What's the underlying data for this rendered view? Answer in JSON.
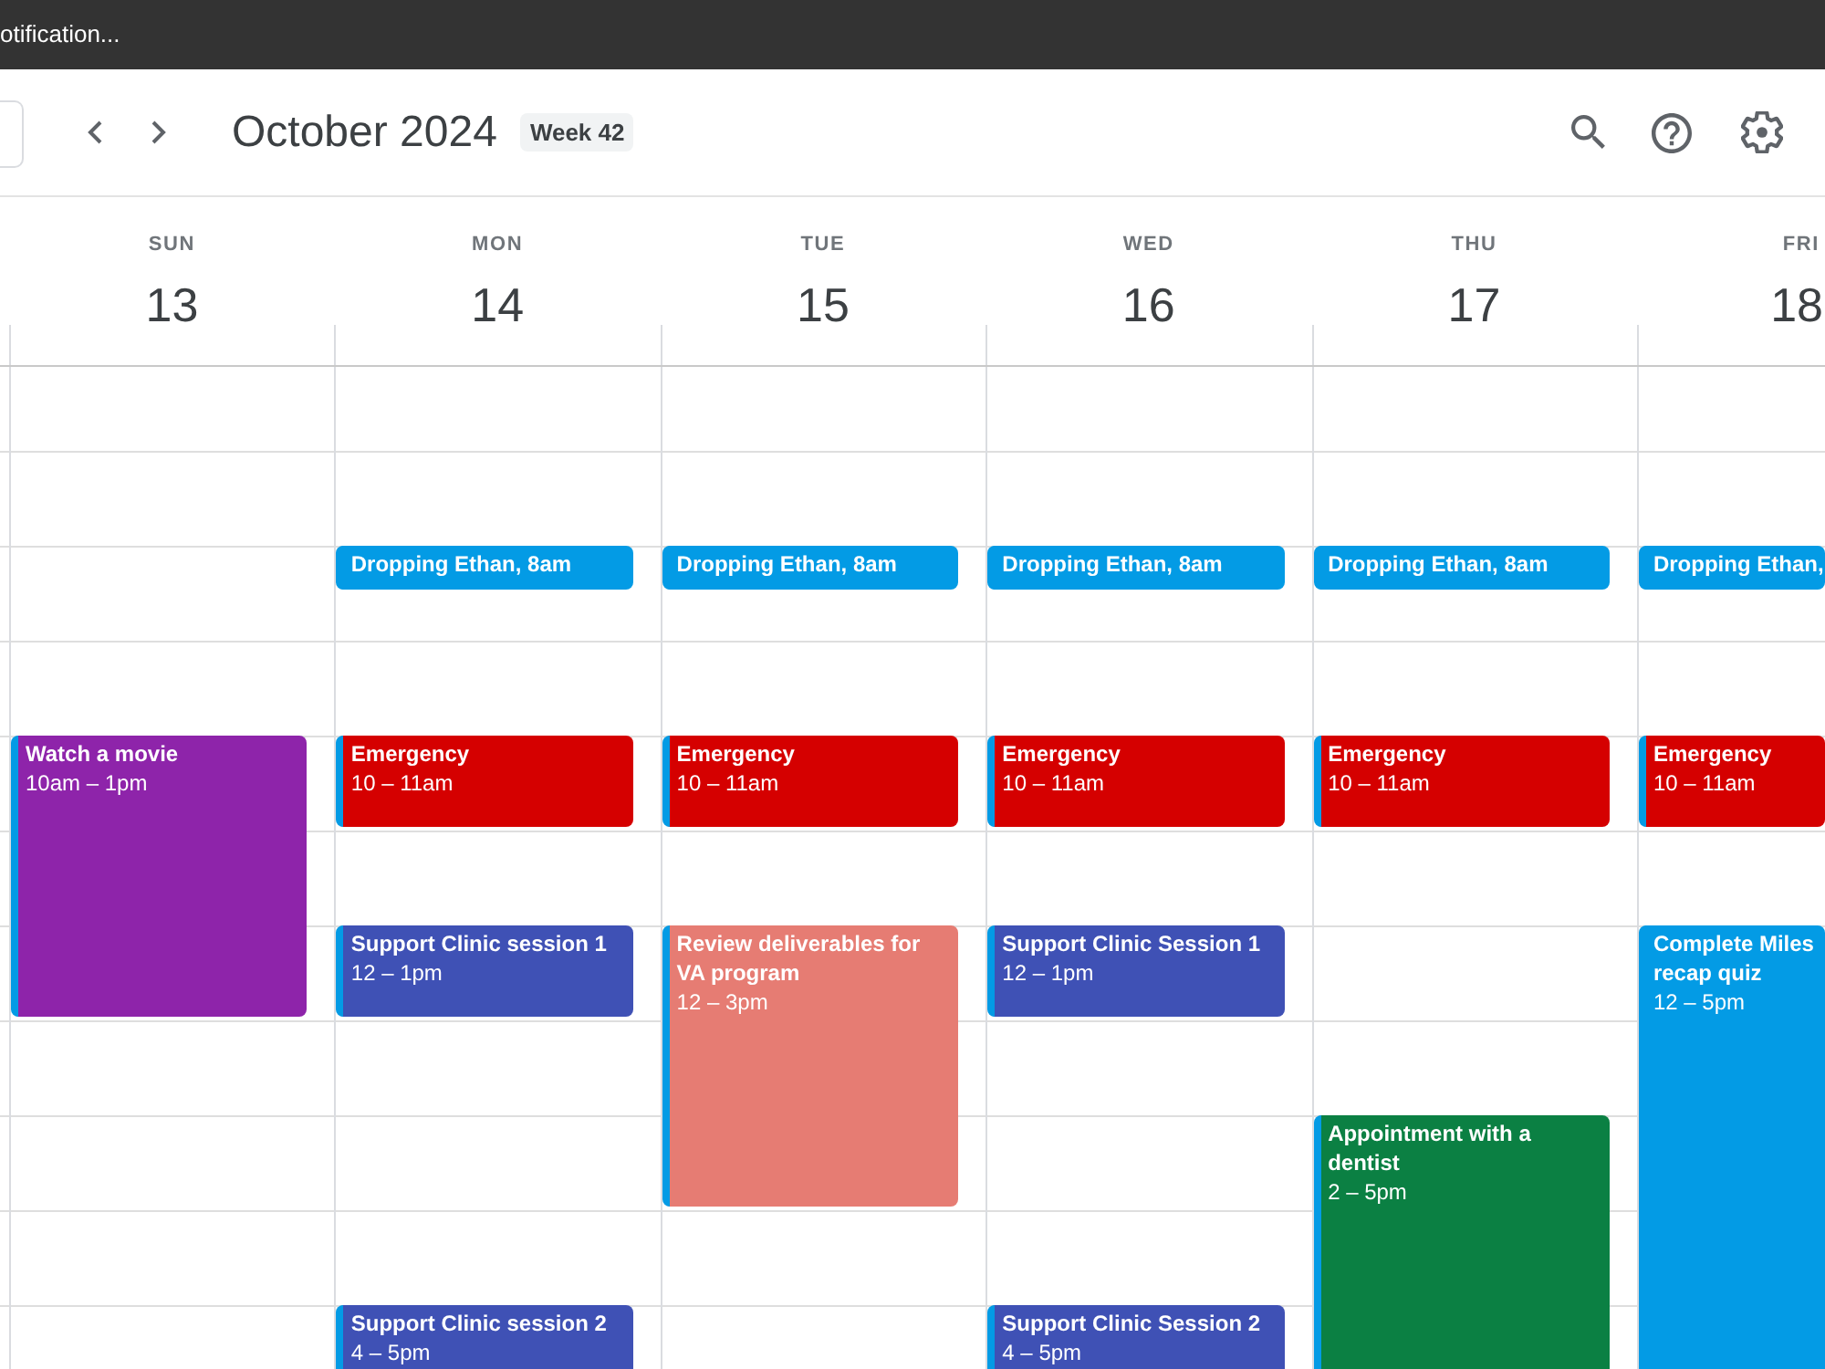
{
  "notification": {
    "text": "otification..."
  },
  "toolbar": {
    "title": "October 2024",
    "week_badge": "Week 42"
  },
  "days": [
    {
      "name": "SUN",
      "date": "13",
      "events": [
        {
          "kind": "block",
          "title": "Watch a movie",
          "time": "10am – 1pm",
          "color": "#8e24aa"
        }
      ]
    },
    {
      "name": "MON",
      "date": "14",
      "events": [
        {
          "kind": "short",
          "title": "Dropping Ethan, 8am",
          "color": "#039be5"
        },
        {
          "kind": "block",
          "title": "Emergency",
          "time": "10 – 11am",
          "color": "#d50000"
        },
        {
          "kind": "block",
          "title": "Support Clinic session 1",
          "time": "12 – 1pm",
          "color": "#3f51b5"
        },
        {
          "kind": "block",
          "title": "Support Clinic session 2",
          "time": "4 – 5pm",
          "color": "#3f51b5"
        }
      ]
    },
    {
      "name": "TUE",
      "date": "15",
      "events": [
        {
          "kind": "short",
          "title": "Dropping Ethan, 8am",
          "color": "#039be5"
        },
        {
          "kind": "block",
          "title": "Emergency",
          "time": "10 – 11am",
          "color": "#d50000"
        },
        {
          "kind": "block",
          "title": "Review deliverables for VA program",
          "time": "12 – 3pm",
          "color": "#e67c73"
        }
      ]
    },
    {
      "name": "WED",
      "date": "16",
      "events": [
        {
          "kind": "short",
          "title": "Dropping Ethan, 8am",
          "color": "#039be5"
        },
        {
          "kind": "block",
          "title": "Emergency",
          "time": "10 – 11am",
          "color": "#d50000"
        },
        {
          "kind": "block",
          "title": "Support Clinic Session 1",
          "time": "12 – 1pm",
          "color": "#3f51b5"
        },
        {
          "kind": "block",
          "title": "Support Clinic Session 2",
          "time": "4 – 5pm",
          "color": "#3f51b5"
        }
      ]
    },
    {
      "name": "THU",
      "date": "17",
      "events": [
        {
          "kind": "short",
          "title": "Dropping Ethan, 8am",
          "color": "#039be5"
        },
        {
          "kind": "block",
          "title": "Emergency",
          "time": "10 – 11am",
          "color": "#d50000"
        },
        {
          "kind": "block",
          "title": "Appointment with a dentist",
          "time": "2 – 5pm",
          "color": "#0b8043"
        }
      ]
    },
    {
      "name": "FRI",
      "date": "18",
      "events": [
        {
          "kind": "short",
          "title": "Dropping Ethan,",
          "color": "#039be5"
        },
        {
          "kind": "block",
          "title": "Emergency",
          "time": "10 – 11am",
          "color": "#d50000"
        },
        {
          "kind": "block",
          "title": "Complete Miles recap quiz",
          "time": "12 – 5pm",
          "color": "#039be5"
        }
      ]
    }
  ]
}
